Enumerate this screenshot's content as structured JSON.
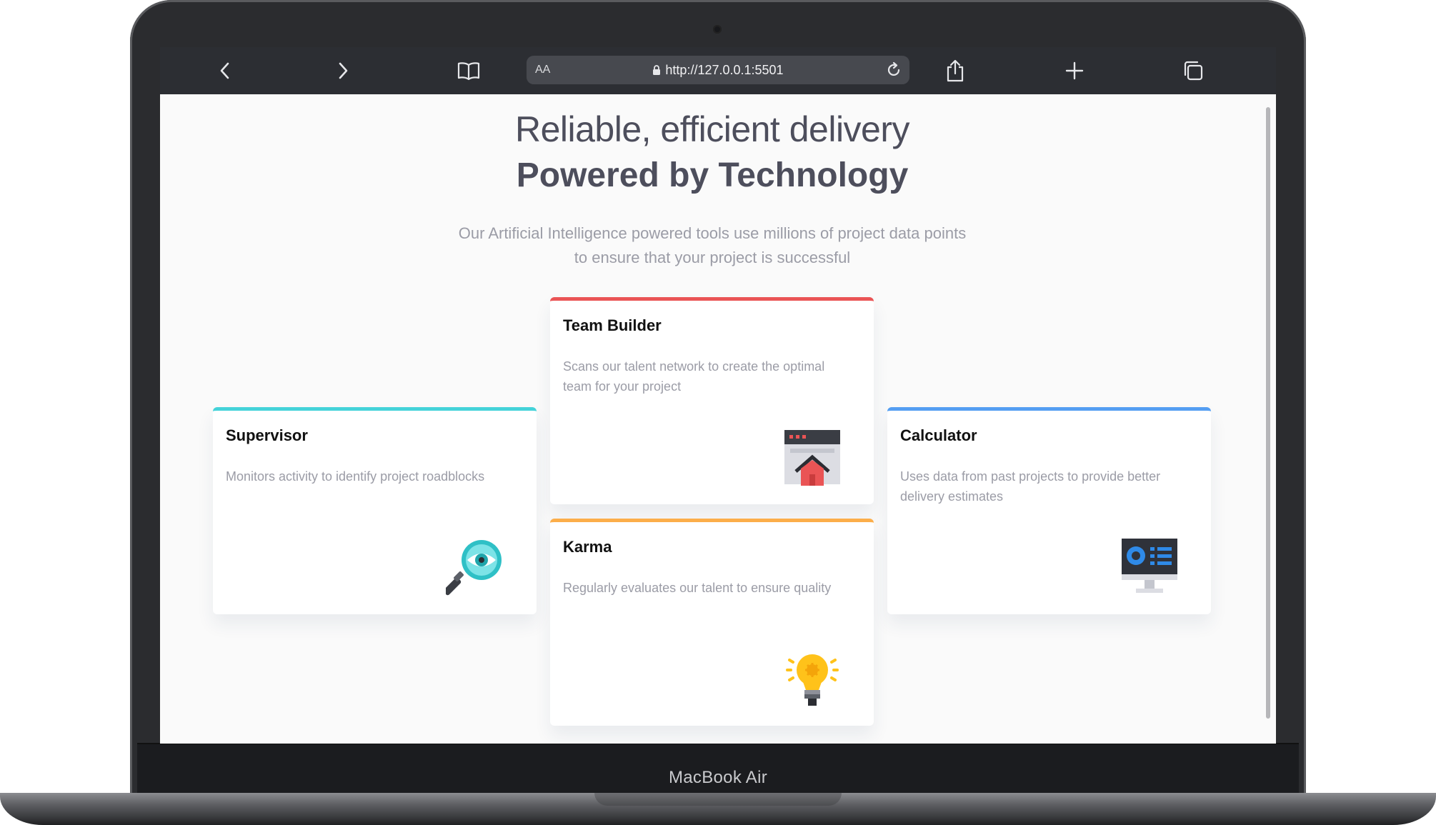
{
  "device": {
    "label": "MacBook Air"
  },
  "browser": {
    "url": "http://127.0.0.1:5501",
    "text_size_label": "AA",
    "buttons": {
      "back": "chevron-left-icon",
      "forward": "chevron-right-icon",
      "bookmarks": "book-icon",
      "reload": "reload-icon",
      "share": "share-icon",
      "new_tab": "plus-icon",
      "tabs": "tabs-icon"
    }
  },
  "page": {
    "heading_light": "Reliable, efficient delivery",
    "heading_bold": "Powered by Technology",
    "subtitle_line1": "Our Artificial Intelligence powered tools use millions of project data points",
    "subtitle_line2": "to ensure that your project is successful",
    "cards": [
      {
        "title": "Supervisor",
        "description": "Monitors activity to identify project roadblocks",
        "accent": "#44d3d9",
        "icon": "magnifier-eye-icon"
      },
      {
        "title": "Team Builder",
        "description": "Scans our talent network to create the optimal team for your project",
        "accent": "#ea5455",
        "icon": "browser-house-icon"
      },
      {
        "title": "Karma",
        "description": "Regularly evaluates our talent to ensure quality",
        "accent": "#fcae4a",
        "icon": "lightbulb-icon"
      },
      {
        "title": "Calculator",
        "description": "Uses data from past projects to provide better delivery estimates",
        "accent": "#549ef2",
        "icon": "monitor-chart-icon"
      }
    ]
  }
}
